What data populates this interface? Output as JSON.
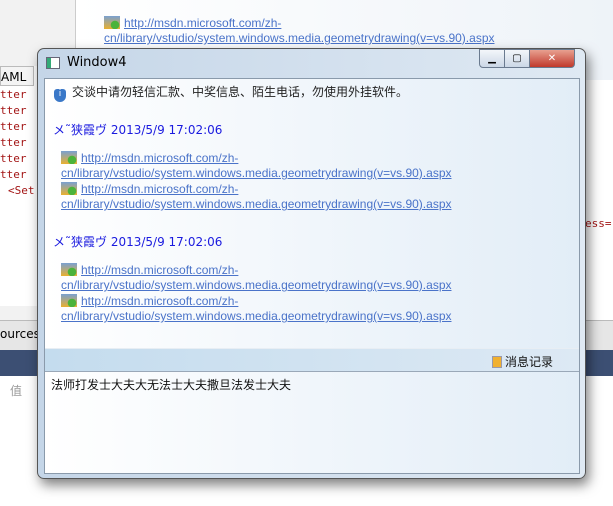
{
  "background": {
    "link": "http://msdn.microsoft.com/zh-cn/library/vstudio/system.windows.media.geometrydrawing(v=vs.90).aspx",
    "tab": "AML",
    "code": [
      "tter",
      "tter",
      "tter",
      "tter",
      "tter",
      "tter",
      "<Set"
    ],
    "resources": "ources,",
    "value_col": "值",
    "attr": "ess=\""
  },
  "window": {
    "title": "Window4",
    "notice": "交谈中请勿轻信汇款、中奖信息、陌生电话，勿使用外挂软件。",
    "messages": [
      {
        "sender": "メ˜狭霞ヴ 2013/5/9 17:02:06",
        "links": [
          "http://msdn.microsoft.com/zh-cn/library/vstudio/system.windows.media.geometrydrawing(v=vs.90).aspx",
          "http://msdn.microsoft.com/zh-cn/library/vstudio/system.windows.media.geometrydrawing(v=vs.90).aspx"
        ]
      },
      {
        "sender": "メ˜狭霞ヴ 2013/5/9 17:02:06",
        "links": [
          "http://msdn.microsoft.com/zh-cn/library/vstudio/system.windows.media.geometrydrawing(v=vs.90).aspx",
          "http://msdn.microsoft.com/zh-cn/library/vstudio/system.windows.media.geometrydrawing(v=vs.90).aspx"
        ]
      }
    ],
    "history_label": "消息记录",
    "input_value": "法师打发士大夫大无法士大夫撒旦法发士大夫"
  }
}
